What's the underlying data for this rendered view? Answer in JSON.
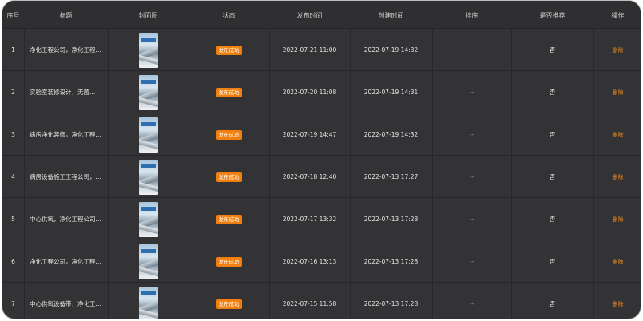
{
  "columns": {
    "index": "序号",
    "title": "标题",
    "cover": "封面图",
    "status": "状态",
    "publish_time": "发布时间",
    "create_time": "创建时间",
    "sort": "排序",
    "recommended": "是否推荐",
    "action": "操作"
  },
  "rows": [
    {
      "index": "1",
      "title": "净化工程公司，净化工程...",
      "status": "发布成功",
      "publish_time": "2022-07-21 11:00",
      "create_time": "2022-07-19 14:32",
      "sort": "--",
      "recommended": "否",
      "action": "删除"
    },
    {
      "index": "2",
      "title": "实验室装修设计，无菌...",
      "status": "发布成功",
      "publish_time": "2022-07-20 11:08",
      "create_time": "2022-07-19 14:31",
      "sort": "--",
      "recommended": "否",
      "action": "删除"
    },
    {
      "index": "3",
      "title": "病房净化装修，净化工程...",
      "status": "发布成功",
      "publish_time": "2022-07-19 14:47",
      "create_time": "2022-07-19 14:32",
      "sort": "--",
      "recommended": "否",
      "action": "删除"
    },
    {
      "index": "4",
      "title": "病房设备施工工程公司，...",
      "status": "发布成功",
      "publish_time": "2022-07-18 12:40",
      "create_time": "2022-07-13 17:27",
      "sort": "--",
      "recommended": "否",
      "action": "删除"
    },
    {
      "index": "5",
      "title": "中心供氧，净化工程公司...",
      "status": "发布成功",
      "publish_time": "2022-07-17 13:32",
      "create_time": "2022-07-13 17:28",
      "sort": "--",
      "recommended": "否",
      "action": "删除"
    },
    {
      "index": "6",
      "title": "净化工程公司，净化工程...",
      "status": "发布成功",
      "publish_time": "2022-07-16 13:13",
      "create_time": "2022-07-13 17:28",
      "sort": "--",
      "recommended": "否",
      "action": "删除"
    },
    {
      "index": "7",
      "title": "中心供氧设备带，净化工...",
      "status": "发布成功",
      "publish_time": "2022-07-15 11:58",
      "create_time": "2022-07-13 17:28",
      "sort": "--",
      "recommended": "否",
      "action": "删除"
    }
  ],
  "colors": {
    "accent": "#f07f0f",
    "background": "#333335",
    "header": "#2f2f31"
  }
}
